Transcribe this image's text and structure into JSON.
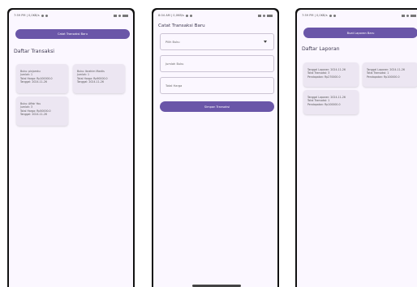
{
  "phone1": {
    "status_time": "7:59 PM | 0,0KB/s",
    "button_label": "Catat Transaksi Baru",
    "title": "Daftar Transaksi",
    "cards": [
      {
        "l1": "Buku: pinjamku",
        "l2": "Jumlah: 1",
        "l3": "Total Harga: Rp100000.0",
        "l4": "Tanggal: 2024-11-26"
      },
      {
        "l1": "Buku: Ibrahim Mantis",
        "l2": "Jumlah: 1",
        "l3": "Total Harga: Rp90000.0",
        "l4": "Tanggal: 2024-11-26"
      },
      {
        "l1": "Buku: Affair You",
        "l2": "Jumlah: 3",
        "l3": "Total Harga: Rp50000.0",
        "l4": "Tanggal: 2024-11-26"
      }
    ]
  },
  "phone2": {
    "status_time": "8:04 AM | 0,0KB/s",
    "title": "Catat Transaksi Baru",
    "select_placeholder": "Pilih Buku",
    "qty_placeholder": "Jumlah Buku",
    "price_placeholder": "Total Harga",
    "submit_label": "Simpan Transaksi"
  },
  "phone3": {
    "status_time": "7:59 PM | 0,0KB/s",
    "button_label": "Buat Laporan Baru",
    "title": "Daftar Laporan",
    "cards": [
      {
        "l1": "Tanggal Laporan: 2024-11-26",
        "l2": "Total Transaksi: 3",
        "l3": "Pendapatan: Rp270000.0"
      },
      {
        "l1": "Tanggal Laporan: 2024-11-26",
        "l2": "Total Transaksi: 1",
        "l3": "Pendapatan: Rp100000.0"
      },
      {
        "l1": "Tanggal Laporan: 2024-11-26",
        "l2": "Total Transaksi: 1",
        "l3": "Pendapatan: Rp100000.0"
      }
    ]
  },
  "colors": {
    "primary": "#6a56a8",
    "card": "#ece6f2",
    "bg": "#fbf7ff"
  }
}
